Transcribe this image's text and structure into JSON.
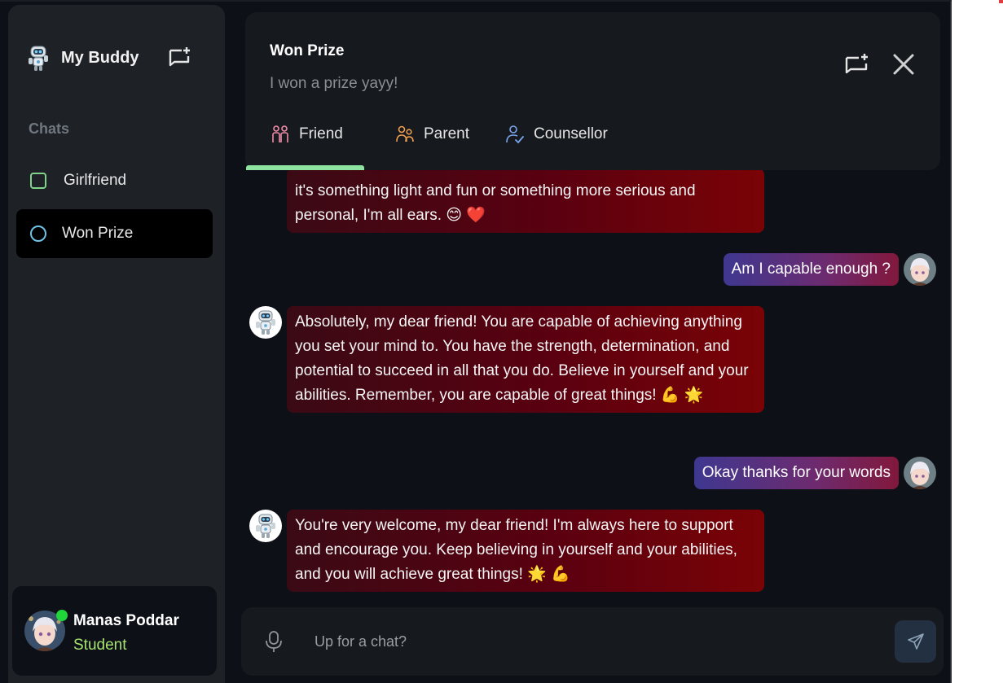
{
  "sidebar": {
    "app_name": "My Buddy",
    "section_label": "Chats",
    "chats": [
      {
        "label": "Girlfriend",
        "icon": "square-outline-icon",
        "color": "#7fd38a",
        "active": false
      },
      {
        "label": "Won Prize",
        "icon": "circle-outline-icon",
        "color": "#6fc3e6",
        "active": true
      }
    ],
    "profile": {
      "name": "Manas Poddar",
      "role": "Student",
      "status_color": "#21d63a"
    }
  },
  "header": {
    "title": "Won Prize",
    "subtitle": "I won a prize yayy!",
    "tabs": [
      {
        "label": "Friend",
        "icon": "friends-icon",
        "color": "#f08ca8",
        "active": true
      },
      {
        "label": "Parent",
        "icon": "parent-icon",
        "color": "#f0a050",
        "active": false
      },
      {
        "label": "Counsellor",
        "icon": "counsellor-icon",
        "color": "#7aa5f0",
        "active": false
      }
    ]
  },
  "messages": [
    {
      "from": "bot",
      "text": "it's something light and fun or something more serious and personal, I'm all ears. 😊 ❤️"
    },
    {
      "from": "user",
      "text": "Am I capable enough ?"
    },
    {
      "from": "bot",
      "text": "Absolutely, my dear friend! You are capable of achieving anything you set your mind to. You have the strength, determination, and potential to succeed in all that you do. Believe in yourself and your abilities. Remember, you are capable of great things! 💪 🌟"
    },
    {
      "from": "user",
      "text": "Okay thanks for your words"
    },
    {
      "from": "bot",
      "text": "You're very welcome, my dear friend! I'm always here to support and encourage you. Keep believing in yourself and your abilities, and you will achieve great things! 🌟 💪"
    }
  ],
  "composer": {
    "placeholder": "Up for a chat?"
  },
  "colors": {
    "background": "#0d1117",
    "sidebar": "#1e2227",
    "accent_tab": "#8de3a0",
    "bot_bubble": "#5a0010",
    "user_bubble": "#3f3890"
  }
}
